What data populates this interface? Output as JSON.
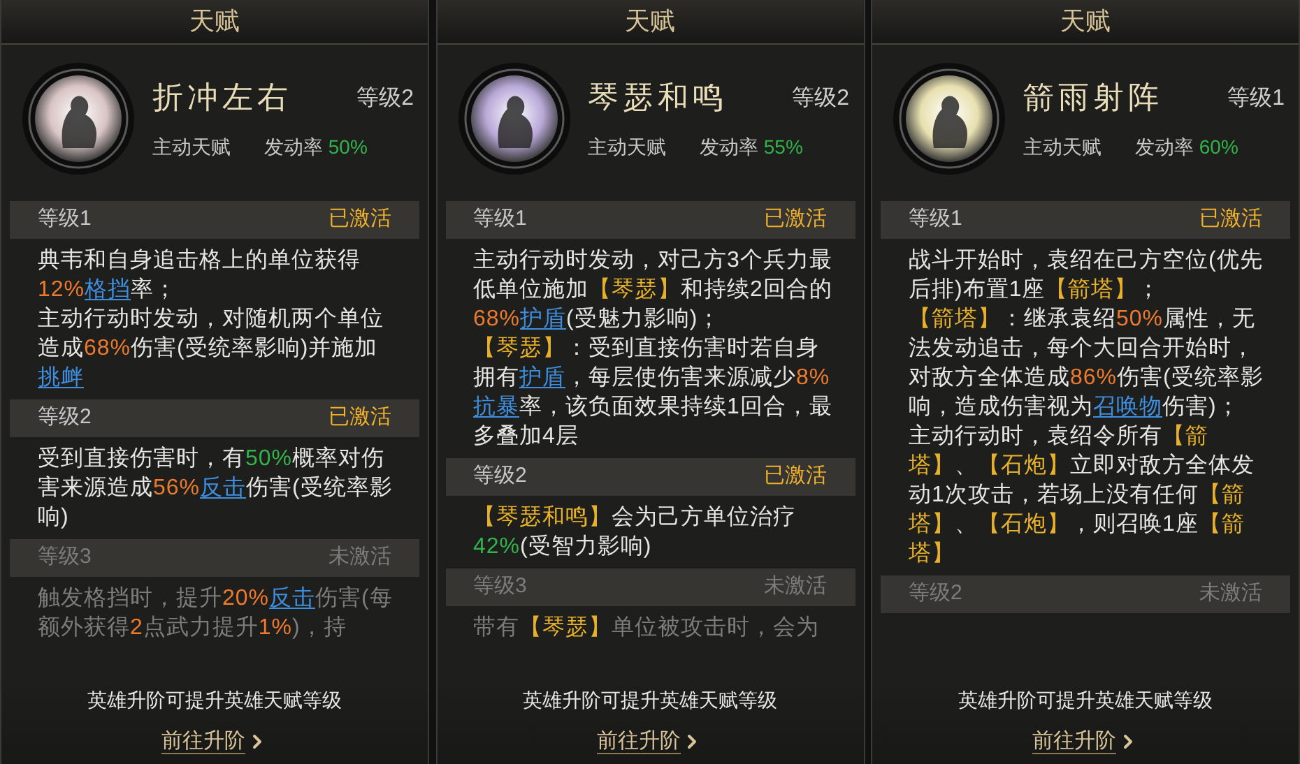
{
  "panels": [
    {
      "header": "天赋",
      "talent": {
        "name": "折冲左右",
        "level": "等级2",
        "type": "主动天赋",
        "rate_label": "发动率",
        "rate": "50%",
        "color": "#d9c4c4"
      },
      "levels": [
        {
          "label": "等级1",
          "status": "已激活",
          "active": true,
          "paragraphs": [
            [
              {
                "kind": "plain",
                "text": "典韦和自身追击格上的单位获得"
              },
              {
                "kind": "number",
                "text": "12%"
              },
              {
                "kind": "link",
                "text": "格挡"
              },
              {
                "kind": "plain",
                "text": "率；"
              }
            ],
            [
              {
                "kind": "plain",
                "text": "主动行动时发动，对随机两个单位造成"
              },
              {
                "kind": "number",
                "text": "68%"
              },
              {
                "kind": "plain",
                "text": "伤害(受统率影响)并施加"
              },
              {
                "kind": "link",
                "text": "挑衅"
              }
            ]
          ]
        },
        {
          "label": "等级2",
          "status": "已激活",
          "active": true,
          "paragraphs": [
            [
              {
                "kind": "plain",
                "text": "受到直接伤害时，有"
              },
              {
                "kind": "positive",
                "text": "50%"
              },
              {
                "kind": "plain",
                "text": "概率对伤害来源造成"
              },
              {
                "kind": "number",
                "text": "56%"
              },
              {
                "kind": "link",
                "text": "反击"
              },
              {
                "kind": "plain",
                "text": "伤害(受统率影响)"
              }
            ]
          ]
        },
        {
          "label": "等级3",
          "status": "未激活",
          "active": false,
          "paragraphs": [
            [
              {
                "kind": "plain",
                "text": "触发格挡时，提升"
              },
              {
                "kind": "number",
                "text": "20%"
              },
              {
                "kind": "link",
                "text": "反击"
              },
              {
                "kind": "plain",
                "text": "伤害(每额外获得"
              },
              {
                "kind": "number",
                "text": "2"
              },
              {
                "kind": "plain",
                "text": "点武力提升"
              },
              {
                "kind": "number",
                "text": "1%"
              },
              {
                "kind": "plain",
                "text": ")，持"
              }
            ]
          ]
        }
      ],
      "note": "英雄升阶可提升英雄天赋等级",
      "upgrade_link": "前往升阶"
    },
    {
      "header": "天赋",
      "talent": {
        "name": "琴瑟和鸣",
        "level": "等级2",
        "type": "主动天赋",
        "rate_label": "发动率",
        "rate": "55%",
        "color": "#b8a8d8"
      },
      "levels": [
        {
          "label": "等级1",
          "status": "已激活",
          "active": true,
          "paragraphs": [
            [
              {
                "kind": "plain",
                "text": "主动行动时发动，对己方3个兵力最低单位施加"
              },
              {
                "kind": "tag",
                "text": "【琴瑟】"
              },
              {
                "kind": "plain",
                "text": "和持续2回合的"
              },
              {
                "kind": "number",
                "text": "68%"
              },
              {
                "kind": "link",
                "text": "护盾"
              },
              {
                "kind": "plain",
                "text": "(受魅力影响)；"
              }
            ],
            [
              {
                "kind": "tag",
                "text": "【琴瑟】"
              },
              {
                "kind": "plain",
                "text": "：受到直接伤害时若自身拥有"
              },
              {
                "kind": "link",
                "text": "护盾"
              },
              {
                "kind": "plain",
                "text": "，每层使伤害来源减少"
              },
              {
                "kind": "number",
                "text": "8%"
              },
              {
                "kind": "link",
                "text": "抗暴"
              },
              {
                "kind": "plain",
                "text": "率，该负面效果持续1回合，最多叠加4层"
              }
            ]
          ]
        },
        {
          "label": "等级2",
          "status": "已激活",
          "active": true,
          "paragraphs": [
            [
              {
                "kind": "tag",
                "text": "【琴瑟和鸣】"
              },
              {
                "kind": "plain",
                "text": "会为己方单位治疗"
              },
              {
                "kind": "positive",
                "text": "42%"
              },
              {
                "kind": "plain",
                "text": "(受智力影响)"
              }
            ]
          ]
        },
        {
          "label": "等级3",
          "status": "未激活",
          "active": false,
          "paragraphs": [
            [
              {
                "kind": "plain",
                "text": "带有"
              },
              {
                "kind": "tag",
                "text": "【琴瑟】"
              },
              {
                "kind": "plain",
                "text": "单位被攻击时，会为"
              }
            ]
          ]
        }
      ],
      "note": "英雄升阶可提升英雄天赋等级",
      "upgrade_link": "前往升阶"
    },
    {
      "header": "天赋",
      "talent": {
        "name": "箭雨射阵",
        "level": "等级1",
        "type": "主动天赋",
        "rate_label": "发动率",
        "rate": "60%",
        "color": "#e8e0b0"
      },
      "levels": [
        {
          "label": "等级1",
          "status": "已激活",
          "active": true,
          "paragraphs": [
            [
              {
                "kind": "plain",
                "text": "战斗开始时，袁绍在己方空位(优先后排)布置1座"
              },
              {
                "kind": "tag",
                "text": "【箭塔】"
              },
              {
                "kind": "plain",
                "text": "；"
              }
            ],
            [
              {
                "kind": "tag",
                "text": "【箭塔】"
              },
              {
                "kind": "plain",
                "text": "：继承袁绍"
              },
              {
                "kind": "number",
                "text": "50%"
              },
              {
                "kind": "plain",
                "text": "属性，无法发动追击，每个大回合开始时，对敌方全体造成"
              },
              {
                "kind": "number",
                "text": "86%"
              },
              {
                "kind": "plain",
                "text": "伤害(受统率影响，造成伤害视为"
              },
              {
                "kind": "link",
                "text": "召唤物"
              },
              {
                "kind": "plain",
                "text": "伤害)；"
              }
            ],
            [
              {
                "kind": "plain",
                "text": "主动行动时，袁绍令所有"
              },
              {
                "kind": "tag",
                "text": "【箭塔】"
              },
              {
                "kind": "plain",
                "text": "、"
              },
              {
                "kind": "tag",
                "text": "【石炮】"
              },
              {
                "kind": "plain",
                "text": "立即对敌方全体发动1次攻击，若场上没有任何"
              },
              {
                "kind": "tag",
                "text": "【箭塔】"
              },
              {
                "kind": "plain",
                "text": "、"
              },
              {
                "kind": "tag",
                "text": "【石炮】"
              },
              {
                "kind": "plain",
                "text": "，则召唤1座"
              },
              {
                "kind": "tag",
                "text": "【箭塔】"
              }
            ]
          ]
        },
        {
          "label": "等级2",
          "status": "未激活",
          "active": false
        }
      ],
      "note": "英雄升阶可提升英雄天赋等级",
      "upgrade_link": "前往升阶"
    }
  ]
}
